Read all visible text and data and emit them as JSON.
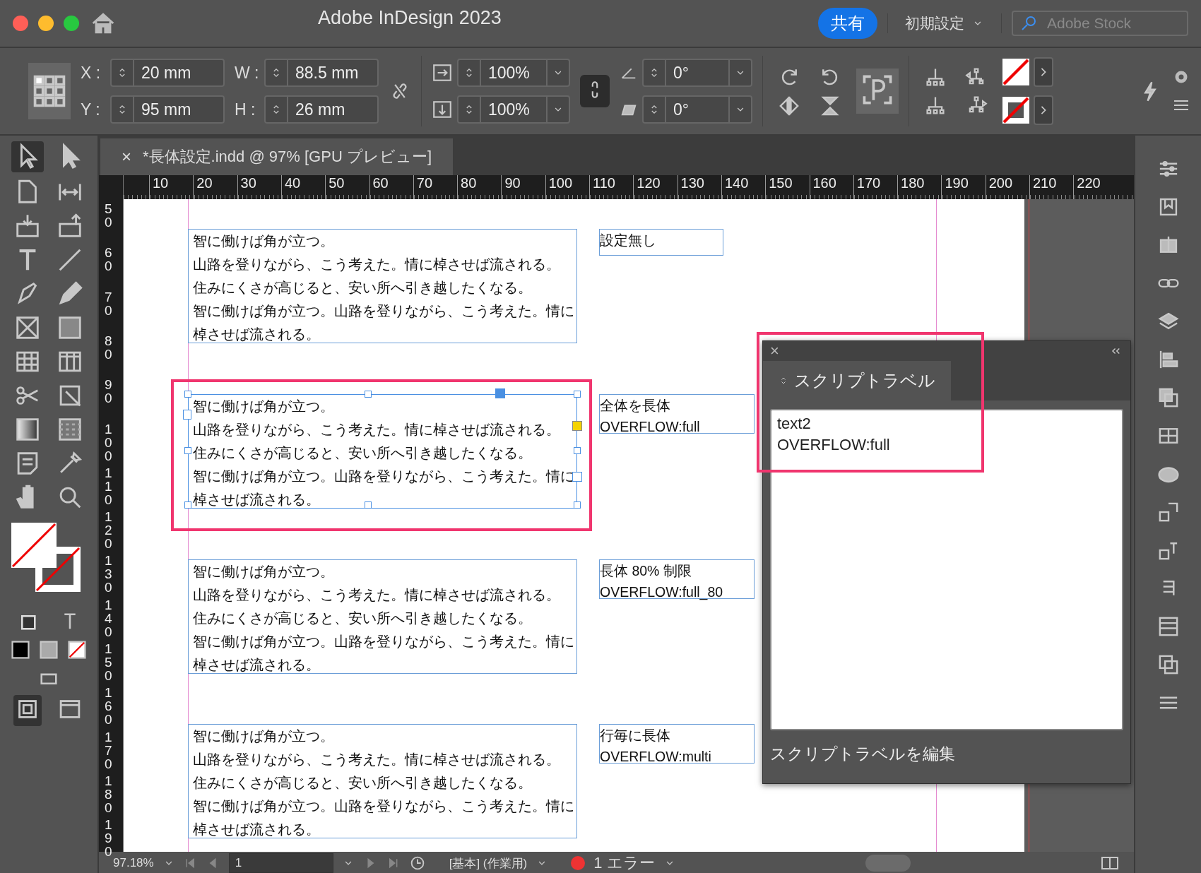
{
  "window": {
    "title": "Adobe InDesign 2023"
  },
  "header": {
    "share": "共有",
    "workspace": "初期設定",
    "search": {
      "placeholder": "Adobe Stock"
    }
  },
  "control_bar": {
    "fields": [
      {
        "label": "X :",
        "value": "20 mm"
      },
      {
        "label": "Y :",
        "value": "95 mm"
      },
      {
        "label": "W :",
        "value": "88.5 mm"
      },
      {
        "label": "H :",
        "value": "26 mm"
      }
    ],
    "scale": [
      "100%",
      "100%"
    ],
    "angles": [
      "0°",
      "0°"
    ]
  },
  "document_tab": {
    "close": "×",
    "title": "*長体設定.indd @ 97% [GPU プレビュー]"
  },
  "ruler": {
    "h_ticks": [
      "10",
      "20",
      "30",
      "40",
      "50",
      "60",
      "70",
      "80",
      "90",
      "100",
      "110",
      "120",
      "130",
      "140",
      "150",
      "160",
      "170",
      "180",
      "190",
      "200",
      "210",
      "220"
    ],
    "v_ticks": [
      "50",
      "60",
      "70",
      "80",
      "90",
      "100",
      "110",
      "120",
      "130",
      "140",
      "150",
      "160",
      "170",
      "180",
      "190"
    ]
  },
  "frames": [
    {
      "selected": false,
      "text": [
        "智に働けば角が立つ。",
        "山路を登りながら、こう考えた。情に棹させば流される。",
        "住みにくさが高じると、安い所へ引き越したくなる。",
        "智に働けば角が立つ。山路を登りながら、こう考えた。情に",
        "棹させば流される。"
      ],
      "label": [
        "設定無し"
      ]
    },
    {
      "selected": true,
      "text": [
        "智に働けば角が立つ。",
        "山路を登りながら、こう考えた。情に棹させば流される。",
        "住みにくさが高じると、安い所へ引き越したくなる。",
        "智に働けば角が立つ。山路を登りながら、こう考えた。情に",
        "棹させば流される。"
      ],
      "label": [
        "全体を長体",
        "OVERFLOW:full"
      ]
    },
    {
      "selected": false,
      "text": [
        "智に働けば角が立つ。",
        "山路を登りながら、こう考えた。情に棹させば流される。",
        "住みにくさが高じると、安い所へ引き越したくなる。",
        "智に働けば角が立つ。山路を登りながら、こう考えた。情に",
        "棹させば流される。"
      ],
      "label": [
        "長体 80% 制限",
        "OVERFLOW:full_80"
      ]
    },
    {
      "selected": false,
      "text": [
        "智に働けば角が立つ。",
        "山路を登りながら、こう考えた。情に棹させば流される。",
        "住みにくさが高じると、安い所へ引き越したくなる。",
        "智に働けば角が立つ。山路を登りながら、こう考えた。情に",
        "棹させば流される。"
      ],
      "label": [
        "行毎に長体",
        "OVERFLOW:multi"
      ]
    }
  ],
  "script_label_panel": {
    "close": "×",
    "title": "スクリプトラベル",
    "lines": [
      "text2",
      "OVERFLOW:full"
    ],
    "footer": "スクリプトラベルを編集"
  },
  "status_bar": {
    "zoom": "97.18%",
    "page": "1",
    "style": "[基本] (作業用)",
    "errors": "1 エラー"
  }
}
